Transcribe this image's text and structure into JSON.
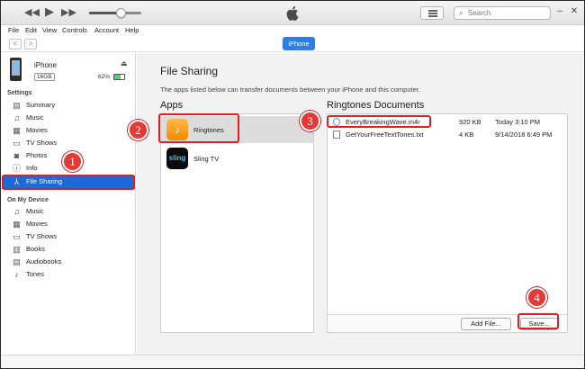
{
  "titlebar": {
    "back_icon": "rewind-icon",
    "play_icon": "play-icon",
    "forward_icon": "fast-forward-icon",
    "volume_level": 0.6,
    "search_placeholder": "Search",
    "minimize": "–",
    "maximize": "□",
    "close": "✕"
  },
  "menu": [
    "File",
    "Edit",
    "View",
    "Controls",
    "Account",
    "Help"
  ],
  "navbar": {
    "device_button": "iPhone"
  },
  "device": {
    "name": "iPhone",
    "capacity": "16GB",
    "battery": "62%",
    "battery_level": 0.62
  },
  "sidebar": {
    "settings_head": "Settings",
    "settings": [
      {
        "label": "Summary",
        "icon": "summary-icon"
      },
      {
        "label": "Music",
        "icon": "music-icon"
      },
      {
        "label": "Movies",
        "icon": "movies-icon"
      },
      {
        "label": "TV Shows",
        "icon": "tv-icon"
      },
      {
        "label": "Photos",
        "icon": "photos-icon"
      },
      {
        "label": "Info",
        "icon": "info-icon"
      },
      {
        "label": "File Sharing",
        "icon": "file-sharing-icon",
        "selected": true
      }
    ],
    "device_head": "On My Device",
    "on_device": [
      {
        "label": "Music",
        "icon": "music-icon"
      },
      {
        "label": "Movies",
        "icon": "movies-icon"
      },
      {
        "label": "TV Shows",
        "icon": "tv-icon"
      },
      {
        "label": "Books",
        "icon": "books-icon"
      },
      {
        "label": "Audiobooks",
        "icon": "audiobooks-icon"
      },
      {
        "label": "Tones",
        "icon": "tones-icon"
      }
    ]
  },
  "main": {
    "title": "File Sharing",
    "description": "The apps listed below can transfer documents between your iPhone and this computer.",
    "apps_head": "Apps",
    "apps": [
      {
        "name": "Ringtones",
        "icon": "ringtones-app-icon",
        "icon_text": "♪"
      },
      {
        "name": "Sling TV",
        "icon": "sling-tv-app-icon",
        "icon_text": "sling"
      }
    ],
    "docs_head": "Ringtones Documents",
    "documents": [
      {
        "name": "EveryBreakingWave.m4r",
        "size": "920 KB",
        "date": "Today 3:10 PM"
      },
      {
        "name": "GetYourFreeTextTones.txt",
        "size": "4 KB",
        "date": "9/14/2018 6:49 PM"
      }
    ],
    "add_file": "Add File...",
    "save": "Save..."
  },
  "annotations": [
    "1",
    "2",
    "3",
    "4"
  ],
  "colors": {
    "accent": "#1c6ad8",
    "marker": "#e53935",
    "highlight": "#e02020"
  }
}
